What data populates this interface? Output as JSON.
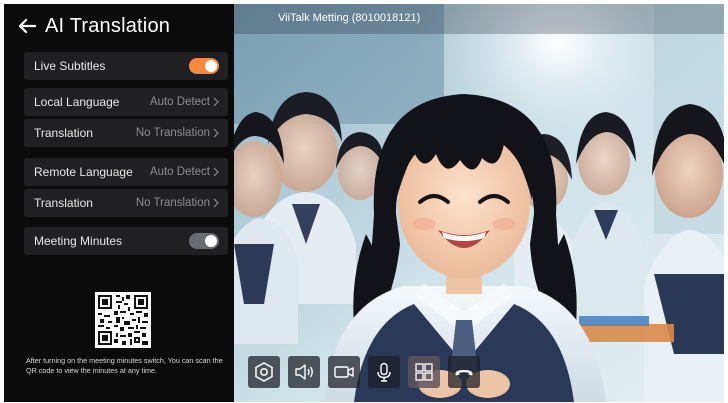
{
  "panel": {
    "title": "AI Translation",
    "rows": {
      "live_subtitles": {
        "label": "Live Subtitles",
        "toggle": "on"
      },
      "local_language": {
        "label": "Local Language",
        "value": "Auto Detect"
      },
      "local_translation": {
        "label": "Translation",
        "value": "No Translation"
      },
      "remote_language": {
        "label": "Remote Language",
        "value": "Auto Detect"
      },
      "remote_translation": {
        "label": "Translation",
        "value": "No Translation"
      },
      "meeting_minutes": {
        "label": "Meeting Minutes",
        "toggle": "off"
      }
    },
    "qr_hint": "After turning on the meeting minutes switch, You can scan the QR code to view the minutes at any time."
  },
  "video": {
    "meeting_title": "ViiTalk Metting (8010018121)"
  },
  "controls": [
    {
      "icon": "settings-hexagon-icon"
    },
    {
      "icon": "speaker-icon"
    },
    {
      "icon": "camera-icon"
    },
    {
      "icon": "microphone-icon"
    },
    {
      "icon": "layout-grid-icon"
    },
    {
      "icon": "hang-up-icon"
    }
  ],
  "colors": {
    "accent": "#f58a3c",
    "panel_bg": "#0b0b0c",
    "row_bg": "#202022",
    "toggle_off": "#6a6b74"
  }
}
